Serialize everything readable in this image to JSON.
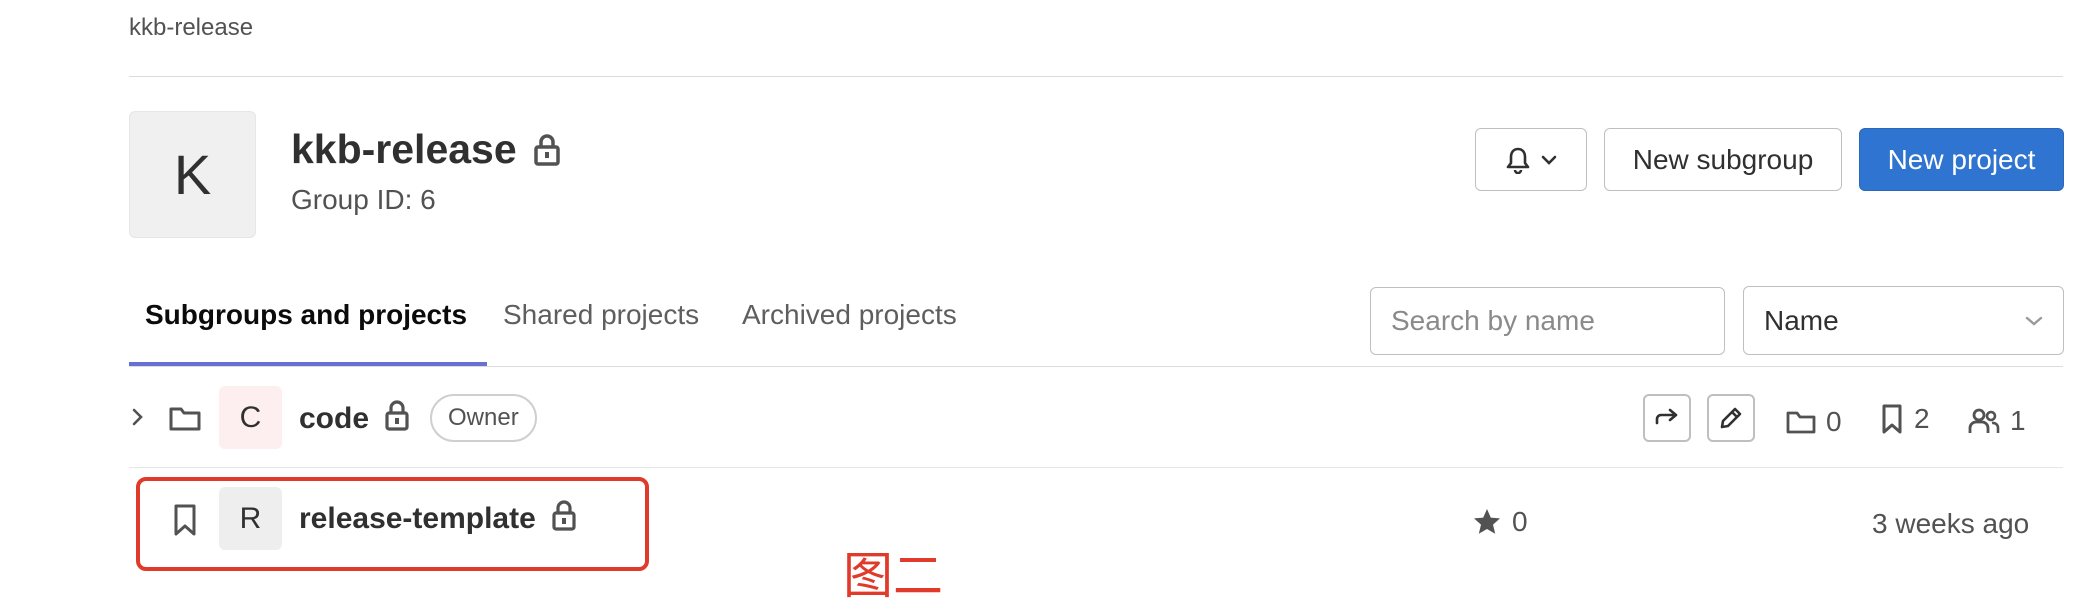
{
  "breadcrumb": {
    "label": "kkb-release"
  },
  "group": {
    "avatar_letter": "K",
    "title": "kkb-release",
    "id_label": "Group ID: 6"
  },
  "header_actions": {
    "notifications_icon": "bell-icon",
    "new_subgroup_label": "New subgroup",
    "new_project_label": "New project"
  },
  "tabs": [
    {
      "label": "Subgroups and projects",
      "active": true
    },
    {
      "label": "Shared projects",
      "active": false
    },
    {
      "label": "Archived projects",
      "active": false
    }
  ],
  "search": {
    "placeholder": "Search by name",
    "value": ""
  },
  "sort": {
    "selected": "Name"
  },
  "rows": [
    {
      "type": "subgroup",
      "avatar_letter": "C",
      "name": "code",
      "badge": "Owner",
      "subgroups_count": "0",
      "projects_count": "2",
      "members_count": "1"
    },
    {
      "type": "project",
      "avatar_letter": "R",
      "name": "release-template",
      "stars_count": "0",
      "updated": "3 weeks ago"
    }
  ],
  "annotation": {
    "text": "图二"
  },
  "colors": {
    "primary_button": "#2f74d0",
    "tab_underline": "#6870d3",
    "highlight": "#e03b2a",
    "subgroup_avatar_bg": "#fdeef0"
  }
}
